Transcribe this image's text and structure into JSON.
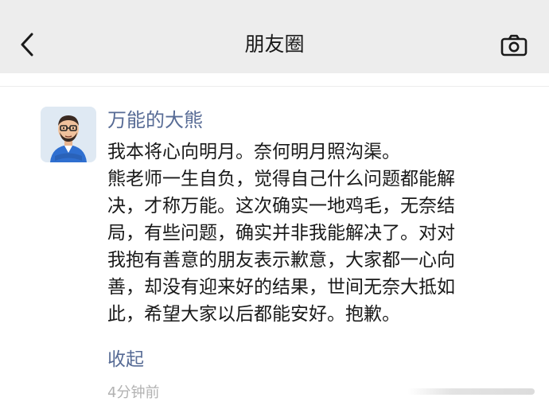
{
  "header": {
    "title": "朋友圈",
    "back_icon": "chevron-left-icon",
    "camera_icon": "camera-icon"
  },
  "post": {
    "username": "万能的大熊",
    "content_lines": [
      "我本将心向明月。奈何明月照沟渠。",
      "熊老师一生自负，觉得自己什么问题都能解",
      "决，才称万能。这次确实一地鸡毛，无奈结",
      "局，有些问题，确实并非我能解决了。对对",
      "我抱有善意的朋友表示歉意，大家都一心向",
      "善，却没有迎来好的结果，世间无奈大抵如",
      "此，希望大家以后都能安好。抱歉。"
    ],
    "collapse_label": "收起",
    "time": "4分钟前"
  },
  "colors": {
    "nickname": "#576b95",
    "header_bg": "#ededed",
    "time": "#b2b2b2"
  }
}
